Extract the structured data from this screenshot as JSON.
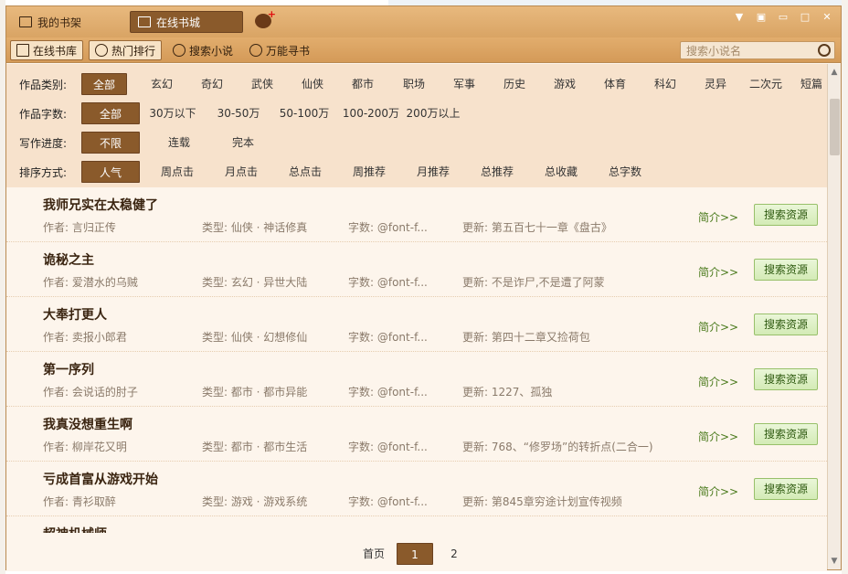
{
  "titlebar": {
    "tab_shelf": "我的书架",
    "tab_store": "在线书城"
  },
  "toolbar": {
    "online_library": "在线书库",
    "hot_ranking": "热门排行",
    "search_novel": "搜索小说",
    "universal_find": "万能寻书",
    "search_placeholder": "搜索小说名"
  },
  "filters": {
    "category": {
      "label": "作品类别:",
      "options": [
        "全部",
        "玄幻",
        "奇幻",
        "武侠",
        "仙侠",
        "都市",
        "职场",
        "军事",
        "历史",
        "游戏",
        "体育",
        "科幻",
        "灵异",
        "二次元",
        "短篇"
      ]
    },
    "wordcount": {
      "label": "作品字数:",
      "options": [
        "全部",
        "30万以下",
        "30-50万",
        "50-100万",
        "100-200万",
        "200万以上"
      ]
    },
    "progress": {
      "label": "写作进度:",
      "options": [
        "不限",
        "连载",
        "完本"
      ]
    },
    "sort": {
      "label": "排序方式:",
      "options": [
        "人气",
        "周点击",
        "月点击",
        "总点击",
        "周推荐",
        "月推荐",
        "总推荐",
        "总收藏",
        "总字数"
      ]
    }
  },
  "books": [
    {
      "title": "我师兄实在太稳健了",
      "author": "作者: 言归正传",
      "type": "类型: 仙侠 · 神话修真",
      "words": "字数: @font-f...",
      "update": "更新: 第五百七十一章《盘古》"
    },
    {
      "title": "诡秘之主",
      "author": "作者: 爱潜水的乌贼",
      "type": "类型: 玄幻 · 异世大陆",
      "words": "字数: @font-f...",
      "update": "更新: 不是诈尸,不是遭了阿蒙"
    },
    {
      "title": "大奉打更人",
      "author": "作者: 卖报小郎君",
      "type": "类型: 仙侠 · 幻想修仙",
      "words": "字数: @font-f...",
      "update": "更新: 第四十二章又捡荷包"
    },
    {
      "title": "第一序列",
      "author": "作者: 会说话的肘子",
      "type": "类型: 都市 · 都市异能",
      "words": "字数: @font-f...",
      "update": "更新: 1227、孤独"
    },
    {
      "title": "我真没想重生啊",
      "author": "作者: 柳岸花又明",
      "type": "类型: 都市 · 都市生活",
      "words": "字数: @font-f...",
      "update": "更新: 768、“修罗场”的转折点(二合一)"
    },
    {
      "title": "亏成首富从游戏开始",
      "author": "作者: 青衫取醉",
      "type": "类型: 游戏 · 游戏系统",
      "words": "字数: @font-f...",
      "update": "更新: 第845章穷途计划宣传视频"
    },
    {
      "title": "超神机械师",
      "author": "",
      "type": "",
      "words": "",
      "update": ""
    }
  ],
  "row_actions": {
    "intro": "简介>>",
    "search": "搜索资源"
  },
  "pager": {
    "first": "首页",
    "p1": "1",
    "p2": "2"
  }
}
